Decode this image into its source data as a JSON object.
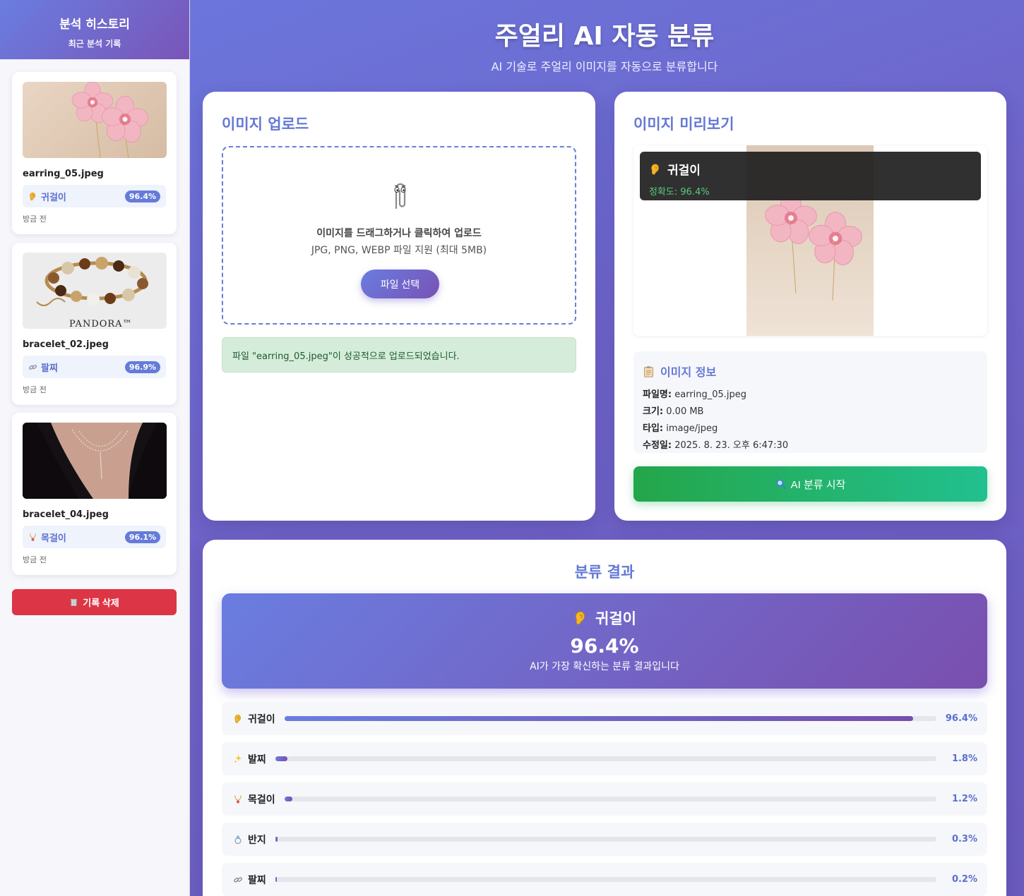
{
  "sidebar": {
    "title": "분석 히스토리",
    "subtitle": "최근 분석 기록",
    "items": [
      {
        "filename": "earring_05.jpeg",
        "label": "귀걸이",
        "icon": "ear-icon",
        "confidence": "96.4%",
        "time": "방금 전"
      },
      {
        "filename": "bracelet_02.jpeg",
        "label": "팔찌",
        "icon": "link-icon",
        "confidence": "96.9%",
        "time": "방금 전",
        "thumb_caption": "PANDORA™"
      },
      {
        "filename": "bracelet_04.jpeg",
        "label": "목걸이",
        "icon": "necklace-icon",
        "confidence": "96.1%",
        "time": "방금 전"
      }
    ],
    "delete_label": "기록 삭제",
    "delete_icon": "trash-icon"
  },
  "header": {
    "title": "주얼리 AI 자동 분류",
    "subtitle": "AI 기술로 주얼리 이미지를 자동으로 분류합니다"
  },
  "upload": {
    "title": "이미지 업로드",
    "icon": "paperclip-icon",
    "drop_main": "이미지를 드래그하거나 클릭하여 업로드",
    "drop_sub": "JPG, PNG, WEBP 파일 지원 (최대 5MB)",
    "button": "파일 선택",
    "success": "파일 \"earring_05.jpeg\"이 성공적으로 업로드되었습니다."
  },
  "preview": {
    "title": "이미지 미리보기",
    "overlay_label": "귀걸이",
    "overlay_accuracy": "정확도: 96.4%",
    "info_title": "이미지 정보",
    "info": [
      {
        "key": "파일명:",
        "value": "earring_05.jpeg"
      },
      {
        "key": "크기:",
        "value": "0.00 MB"
      },
      {
        "key": "타입:",
        "value": "image/jpeg"
      },
      {
        "key": "수정일:",
        "value": "2025. 8. 23. 오후 6:47:30"
      }
    ],
    "ai_button": "AI 분류 시작"
  },
  "results": {
    "title": "분류 결과",
    "top_label": "귀걸이",
    "top_accuracy": "96.4%",
    "top_caption": "AI가 가장 확신하는 분류 결과입니다",
    "rows": [
      {
        "label": "귀걸이",
        "icon": "ear-icon",
        "value": 96.4,
        "display": "96.4%"
      },
      {
        "label": "발찌",
        "icon": "sparkles-icon",
        "value": 1.8,
        "display": "1.8%"
      },
      {
        "label": "목걸이",
        "icon": "necklace-icon",
        "value": 1.2,
        "display": "1.2%"
      },
      {
        "label": "반지",
        "icon": "ring-icon",
        "value": 0.3,
        "display": "0.3%"
      },
      {
        "label": "팔찌",
        "icon": "link-icon",
        "value": 0.2,
        "display": "0.2%"
      }
    ]
  },
  "colors": {
    "accent": "#6478d6",
    "gradient_start": "#6a7de0",
    "gradient_end": "#7a4fae",
    "danger": "#dc3545",
    "success_bg": "#d5ecdb",
    "green_button": "#24a64a"
  }
}
